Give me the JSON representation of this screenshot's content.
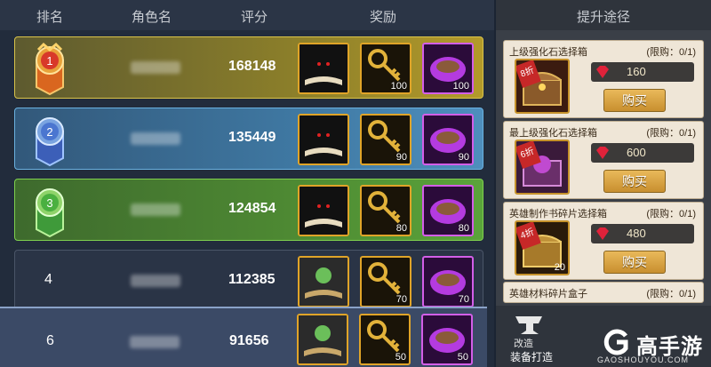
{
  "header": {
    "rank": "排名",
    "name": "角色名",
    "score": "评分",
    "reward": "奖励"
  },
  "rows": [
    {
      "rank": "1",
      "score": "168148",
      "qty_key": "100",
      "qty_food": "100"
    },
    {
      "rank": "2",
      "score": "135449",
      "qty_key": "90",
      "qty_food": "90"
    },
    {
      "rank": "3",
      "score": "124854",
      "qty_key": "80",
      "qty_food": "80"
    },
    {
      "rank": "4",
      "score": "112385",
      "qty_key": "70",
      "qty_food": "70"
    },
    {
      "rank": "6",
      "score": "91656",
      "qty_key": "50",
      "qty_food": "50"
    }
  ],
  "side": {
    "title": "提升途径",
    "cards": [
      {
        "title": "上级强化石选择箱",
        "limit": "(限购：0/1)",
        "discount": "8折",
        "price": "160",
        "buy": "购买"
      },
      {
        "title": "最上级强化石选择箱",
        "limit": "(限购：0/1)",
        "discount": "6折",
        "price": "600",
        "buy": "购买"
      },
      {
        "title": "英雄制作书碎片选择箱",
        "limit": "(限购：0/1)",
        "discount": "4折",
        "price": "480",
        "buy": "购买",
        "count": "20"
      },
      {
        "title": "英雄材料碎片盒子",
        "limit": "(限购：0/1)"
      }
    ],
    "forge_label": "改造",
    "forge_button": "装备打造"
  },
  "brand": {
    "name": "高手游",
    "url": "GAOSHOUYOU.COM"
  },
  "colors": {
    "gold_row": "#8c7f2a",
    "blue_row": "#3f78a2",
    "green_row": "#4e8a33",
    "buy_button": "#d9a446"
  },
  "icons": {
    "reward1": "dark-book-icon",
    "reward2": "golden-key-icon",
    "reward3": "purple-bowl-icon",
    "gem": "ruby-gem-icon",
    "forge": "anvil-icon",
    "brand": "g-logo-icon"
  }
}
